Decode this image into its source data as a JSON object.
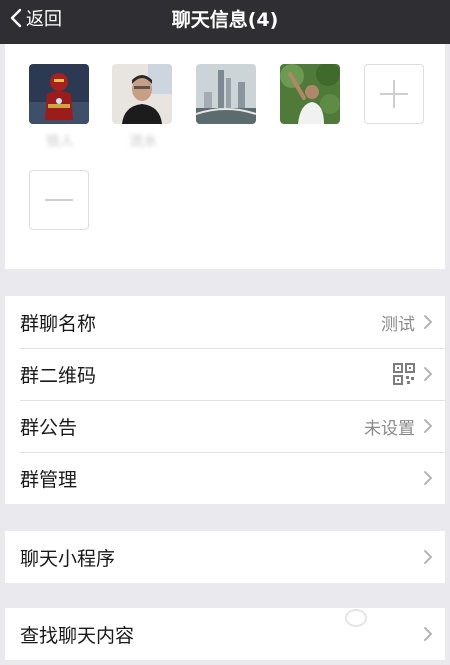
{
  "nav": {
    "back_label": "返回",
    "title": "聊天信息(4)"
  },
  "members": [
    {
      "name": "铁人",
      "avatar_icon": "ironman-avatar-icon"
    },
    {
      "name": "流水",
      "avatar_icon": "man-portrait-avatar-icon"
    },
    {
      "name": "",
      "avatar_icon": "city-skyline-avatar-icon"
    },
    {
      "name": "",
      "avatar_icon": "man-in-trees-avatar-icon"
    }
  ],
  "settings_group": [
    {
      "label": "群聊名称",
      "value": "测试"
    },
    {
      "label": "群二维码",
      "value": ""
    },
    {
      "label": "群公告",
      "value": "未设置"
    },
    {
      "label": "群管理",
      "value": ""
    }
  ],
  "mini_program": {
    "label": "聊天小程序"
  },
  "search": {
    "label": "查找聊天内容"
  },
  "colors": {
    "navbar": "#2e2e33",
    "background": "#e9e9ee",
    "row_text": "#1a1a1a",
    "value_text": "#8a8a8a"
  }
}
